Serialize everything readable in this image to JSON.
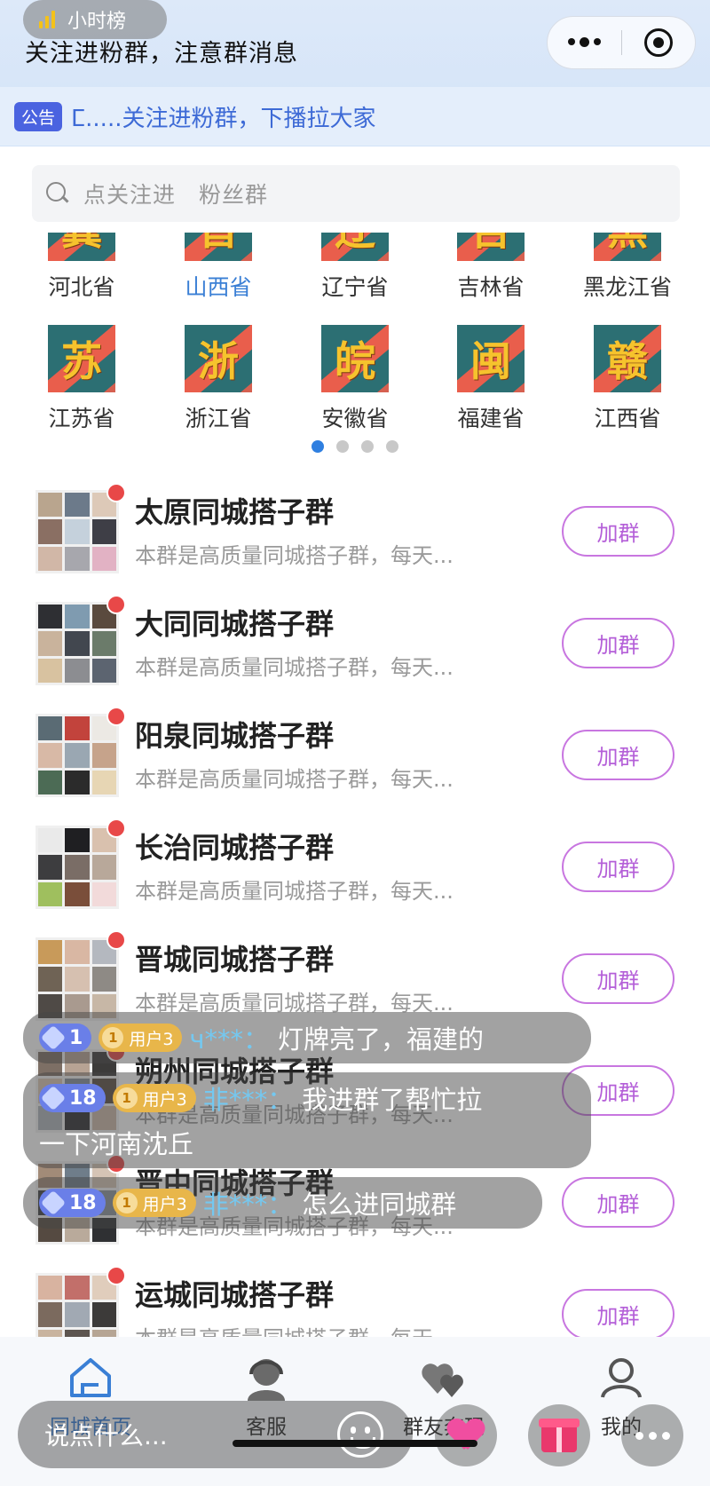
{
  "header": {
    "rank_label": "小时榜",
    "title": "关注进粉群，注意群消息"
  },
  "notice": {
    "badge": "公告",
    "text": "ⵎ.....关注进粉群，下播拉大家"
  },
  "search": {
    "placeholder": "点关注进　粉丝群"
  },
  "provinces_row1": [
    {
      "char": "冀",
      "name": "河北省"
    },
    {
      "char": "晋",
      "name": "山西省",
      "active": true
    },
    {
      "char": "辽",
      "name": "辽宁省"
    },
    {
      "char": "吉",
      "name": "吉林省"
    },
    {
      "char": "黑",
      "name": "黑龙江省"
    }
  ],
  "provinces_row2": [
    {
      "char": "苏",
      "name": "江苏省"
    },
    {
      "char": "浙",
      "name": "浙江省"
    },
    {
      "char": "皖",
      "name": "安徽省"
    },
    {
      "char": "闽",
      "name": "福建省"
    },
    {
      "char": "赣",
      "name": "江西省"
    }
  ],
  "pager": {
    "count": 4,
    "active": 1
  },
  "groups": [
    {
      "name": "太原同城搭子群",
      "desc": "本群是高质量同城搭子群，每天...",
      "join": "加群"
    },
    {
      "name": "大同同城搭子群",
      "desc": "本群是高质量同城搭子群，每天...",
      "join": "加群"
    },
    {
      "name": "阳泉同城搭子群",
      "desc": "本群是高质量同城搭子群，每天...",
      "join": "加群"
    },
    {
      "name": "长治同城搭子群",
      "desc": "本群是高质量同城搭子群，每天...",
      "join": "加群"
    },
    {
      "name": "晋城同城搭子群",
      "desc": "本群是高质量同城搭子群，每天...",
      "join": "加群"
    },
    {
      "name": "朔州同城搭子群",
      "desc": "本群是高质量同城搭子群，每天...",
      "join": "加群"
    },
    {
      "name": "晋中同城搭子群",
      "desc": "本群是高质量同城搭子群，每天...",
      "join": "加群"
    },
    {
      "name": "运城同城搭子群",
      "desc": "本群是高质量同城搭子群，每天...",
      "join": "加群"
    }
  ],
  "tabs": [
    {
      "label": "同城首页",
      "icon": "home-icon",
      "active": true
    },
    {
      "label": "客服",
      "icon": "customer-service-icon"
    },
    {
      "label": "群友奔现",
      "icon": "hearts-icon"
    },
    {
      "label": "我的",
      "icon": "user-icon"
    }
  ],
  "chat": [
    {
      "level": "1",
      "fan": "用户3",
      "user": "ч***：",
      "msg": "灯牌亮了，福建的"
    },
    {
      "level": "18",
      "fan": "用户3",
      "user": "非***：",
      "msg": "我进群了帮忙拉",
      "msg2": "一下河南沈丘"
    },
    {
      "level": "18",
      "fan": "用户3",
      "user": "非***：",
      "msg": "怎么进同城群"
    }
  ],
  "live": {
    "say_placeholder": "说点什么..."
  },
  "colors": {
    "accent": "#3a7fd5",
    "join_border": "#c876e0",
    "red_dot": "#e84848",
    "province_bg": "#2c6f73",
    "province_stripe": "#e95e4c",
    "province_char": "#f6c32d"
  }
}
